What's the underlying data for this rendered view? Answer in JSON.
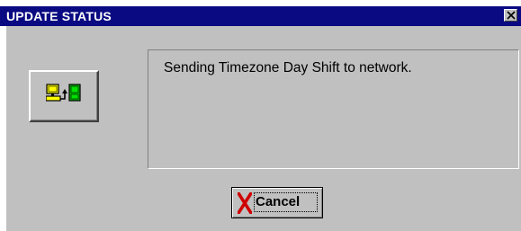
{
  "window": {
    "title": "UPDATE STATUS",
    "title_bar_color": "#0a0a82",
    "title_text_color": "#ffffff",
    "face_color": "#c0c0c0"
  },
  "status_icon": {
    "icon": "computer-to-network-icon",
    "colors": {
      "computer": "#ffff00",
      "network": "#00c000"
    }
  },
  "message": {
    "text": "Sending Timezone Day Shift to network."
  },
  "cancel_button": {
    "label": "Cancel",
    "icon": "red-x-icon",
    "icon_color": "#d00000"
  },
  "close_button": {
    "icon": "close-icon"
  }
}
